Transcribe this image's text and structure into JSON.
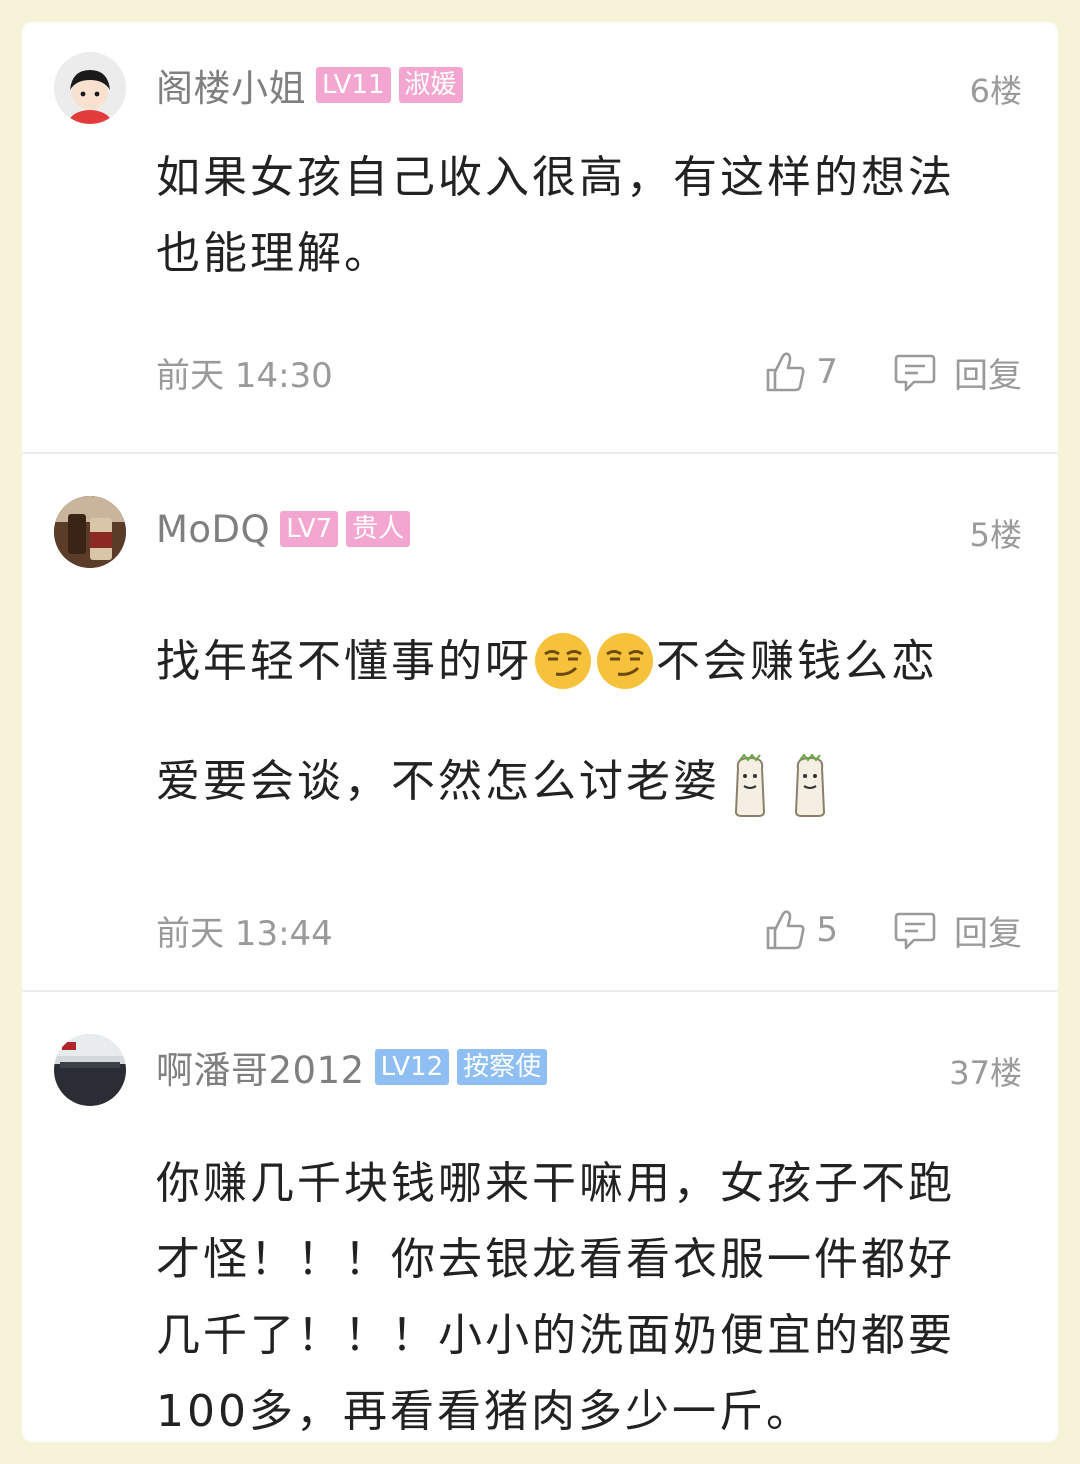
{
  "comments": [
    {
      "username": "阁楼小姐",
      "level": "LV11",
      "title": "淑媛",
      "floor": "6楼",
      "body_lines": [
        "如果女孩自己收入很高，有这样的想法",
        "也能理解。"
      ],
      "time": "前天 14:30",
      "likes": "7",
      "reply_label": "回复",
      "badge_color": "#f3a6cf"
    },
    {
      "username": "MoDQ",
      "level": "LV7",
      "title": "贵人",
      "floor": "5楼",
      "line1_part1": "找年轻不懂事的呀",
      "line1_part2": "不会赚钱么恋",
      "line2": "爱要会谈，不然怎么讨老婆",
      "time": "前天 13:44",
      "likes": "5",
      "reply_label": "回复",
      "badge_color": "#f3a6cf"
    },
    {
      "username": "啊潘哥2012",
      "level": "LV12",
      "title": "按察使",
      "floor": "37楼",
      "body_lines": [
        "你赚几千块钱哪来干嘛用，女孩子不跑",
        "才怪！！！你去银龙看看衣服一件都好",
        "几千了！！！小小的洗面奶便宜的都要",
        "100多，再看看猪肉多少一斤。"
      ],
      "badge_color": "#8fbff2"
    }
  ],
  "icons": {
    "like": "thumbs-up-icon",
    "reply": "comment-bubble-icon",
    "emoji": "smirk-emoji-icon",
    "sticker": "meme-sticker-icon"
  }
}
